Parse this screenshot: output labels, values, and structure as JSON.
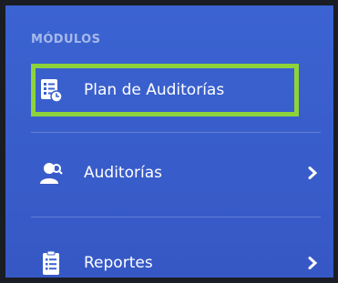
{
  "sidebar": {
    "section_title": "MÓDULOS",
    "items": [
      {
        "label": "Plan de Auditorías",
        "icon": "checklist-clock-icon",
        "highlighted": true,
        "has_submenu": false
      },
      {
        "label": "Auditorías",
        "icon": "auditor-user-icon",
        "highlighted": false,
        "has_submenu": true
      },
      {
        "label": "Reportes",
        "icon": "clipboard-report-icon",
        "highlighted": false,
        "has_submenu": true
      }
    ]
  },
  "colors": {
    "sidebar_bg": "#3b63d1",
    "highlight_border": "#8ed33a",
    "text": "#ffffff"
  }
}
